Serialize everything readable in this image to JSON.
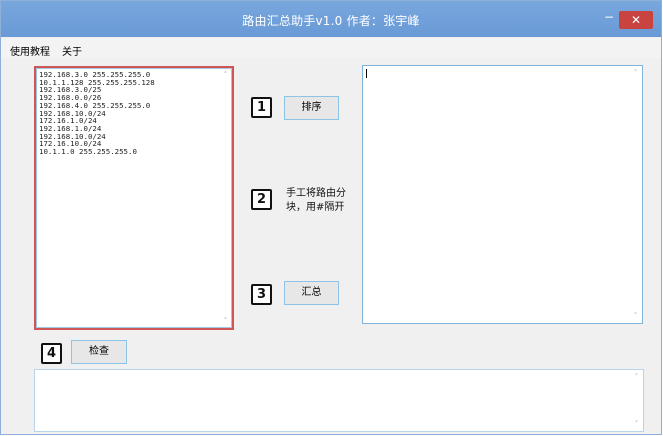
{
  "window": {
    "title": "路由汇总助手v1.0  作者：张宇峰",
    "minimize_label": "−",
    "close_label": "✕"
  },
  "menu": {
    "items": [
      {
        "label": "使用教程"
      },
      {
        "label": "关于"
      }
    ]
  },
  "input": {
    "text": "192.168.3.0 255.255.255.0\n10.1.1.128 255.255.255.128\n192.168.3.0/25\n192.168.0.0/26\n192.168.4.0 255.255.255.0\n192.168.10.0/24\n172.16.1.0/24\n192.168.1.0/24\n192.168.10.0/24\n172.16.10.0/24\n10.1.1.0 255.255.255.0"
  },
  "steps": {
    "step1": "1",
    "step2": "2",
    "step3": "3",
    "step4": "4"
  },
  "buttons": {
    "sort": "排序",
    "summarize": "汇总",
    "check": "检查"
  },
  "hint": {
    "line1": "手工将路由分",
    "line2": "块，用#隔开"
  },
  "scroll": {
    "up": "˄",
    "down": "˅"
  },
  "colors": {
    "titlebar": "#6a9ad6",
    "close": "#c94340",
    "input_border": "#d05555",
    "field_border": "#7fb3da"
  }
}
